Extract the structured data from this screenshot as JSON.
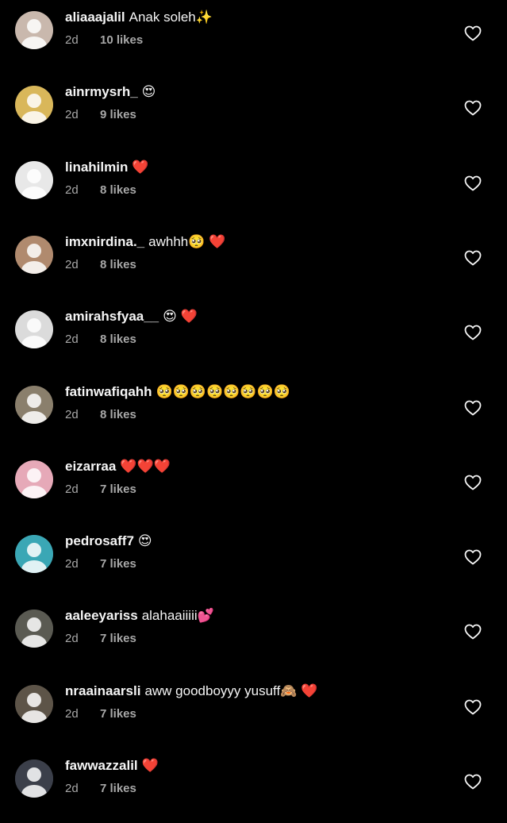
{
  "colors": {
    "background": "#000000",
    "text_primary": "#f5f5f5",
    "text_secondary": "#a8a8a8"
  },
  "comments": [
    {
      "username": "aliaaajalil",
      "text": "Anak soleh✨",
      "time": "2d",
      "likes": "10 likes",
      "avatar_color": "#c9b8ad"
    },
    {
      "username": "ainrmysrh_",
      "text": "😍",
      "time": "2d",
      "likes": "9 likes",
      "avatar_color": "#d9b75a"
    },
    {
      "username": "linahilmin",
      "text": "❤️",
      "time": "2d",
      "likes": "8 likes",
      "avatar_color": "#e8e8e8"
    },
    {
      "username": "imxnirdina._",
      "text": "awhhh🥺 ❤️",
      "time": "2d",
      "likes": "8 likes",
      "avatar_color": "#b08a6e"
    },
    {
      "username": "amirahsfyaa__",
      "text": "😍 ❤️",
      "time": "2d",
      "likes": "8 likes",
      "avatar_color": "#dbdbdb"
    },
    {
      "username": "fatinwafiqahh",
      "text": "🥺🥺🥺🥺🥺🥺🥺🥺",
      "time": "2d",
      "likes": "8 likes",
      "avatar_color": "#8a7f6c"
    },
    {
      "username": "eizarraa",
      "text": "❤️❤️❤️",
      "time": "2d",
      "likes": "7 likes",
      "avatar_color": "#e6a9b8"
    },
    {
      "username": "pedrosaff7",
      "text": "😍",
      "time": "2d",
      "likes": "7 likes",
      "avatar_color": "#3aa7b5"
    },
    {
      "username": "aaleeyariss",
      "text": "alahaaiiiii💕",
      "time": "2d",
      "likes": "7 likes",
      "avatar_color": "#5a5a52"
    },
    {
      "username": "nraainaarsli",
      "text": "aww goodboyyy yusuff🙈 ❤️",
      "time": "2d",
      "likes": "7 likes",
      "avatar_color": "#5d5448"
    },
    {
      "username": "fawwazzalil",
      "text": "❤️",
      "time": "2d",
      "likes": "7 likes",
      "avatar_color": "#3b3f4a"
    }
  ]
}
